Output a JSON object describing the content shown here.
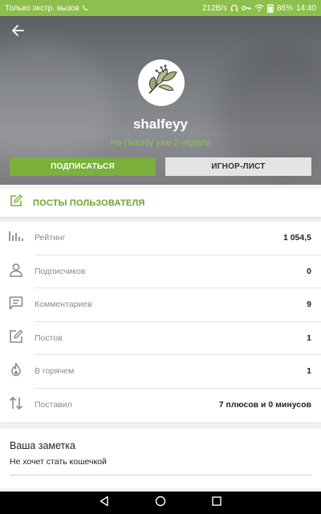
{
  "status_bar": {
    "carrier": "Только экстр. вызов",
    "speed": "212B/s",
    "battery": "86%",
    "time": "14:40"
  },
  "profile": {
    "username": "shalfeyy",
    "since": "На Пикабу уже 2 недели",
    "subscribe_label": "ПОДПИСАТЬСЯ",
    "ignore_label": "ИГНОР-ЛИСТ"
  },
  "posts_link": {
    "label": "ПОСТЫ ПОЛЬЗОВАТЕЛЯ"
  },
  "stats": [
    {
      "icon": "bar-chart-icon",
      "label": "Рейтинг",
      "value": "1 054,5"
    },
    {
      "icon": "person-icon",
      "label": "Подписчиков",
      "value": "0"
    },
    {
      "icon": "comment-icon",
      "label": "Комментариев",
      "value": "9"
    },
    {
      "icon": "edit-icon",
      "label": "Постов",
      "value": "1"
    },
    {
      "icon": "fire-icon",
      "label": "В горячем",
      "value": "1"
    },
    {
      "icon": "up-down-arrows-icon",
      "label": "Поставил",
      "value": "7 плюсов и 0 минусов"
    }
  ],
  "note": {
    "title": "Ваша заметка",
    "text": "Не хочет стать кошечкой"
  },
  "colors": {
    "accent_green": "#7ab03b",
    "status_bar": "#8cbf4d",
    "since_text": "#8cc152"
  }
}
